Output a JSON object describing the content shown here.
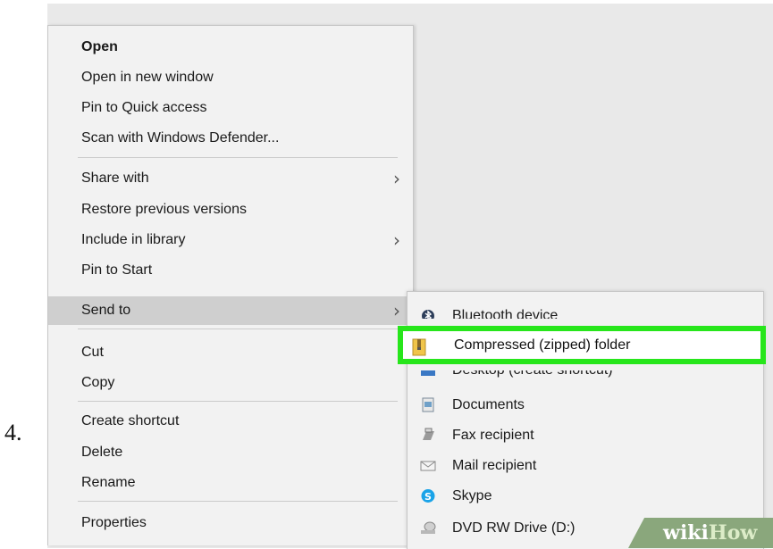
{
  "step_number": "4.",
  "context_menu": {
    "items": [
      {
        "label": "Open",
        "bold": true
      },
      {
        "label": "Open in new window"
      },
      {
        "label": "Pin to Quick access"
      },
      {
        "label": "Scan with Windows Defender..."
      },
      {
        "label": "Share with",
        "submenu": true
      },
      {
        "label": "Restore previous versions"
      },
      {
        "label": "Include in library",
        "submenu": true
      },
      {
        "label": "Pin to Start"
      },
      {
        "label": "Send to",
        "submenu": true,
        "highlighted": true
      },
      {
        "label": "Cut"
      },
      {
        "label": "Copy"
      },
      {
        "label": "Create shortcut"
      },
      {
        "label": "Delete"
      },
      {
        "label": "Rename"
      },
      {
        "label": "Properties"
      }
    ]
  },
  "send_to_submenu": {
    "items": [
      {
        "label": "Bluetooth device",
        "icon": "bluetooth-icon"
      },
      {
        "label": "Compressed (zipped) folder",
        "icon": "zip-folder-icon",
        "highlighted": true
      },
      {
        "label": "Desktop (create shortcut)",
        "icon": "desktop-icon"
      },
      {
        "label": "Documents",
        "icon": "documents-icon"
      },
      {
        "label": "Fax recipient",
        "icon": "fax-icon"
      },
      {
        "label": "Mail recipient",
        "icon": "mail-icon"
      },
      {
        "label": "Skype",
        "icon": "skype-icon"
      },
      {
        "label": "DVD RW Drive (D:)",
        "icon": "dvd-drive-icon"
      }
    ]
  },
  "watermark": {
    "part1": "wiki",
    "part2": "How"
  },
  "colors": {
    "highlight_box": "#27e61b",
    "menu_bg": "#f2f2f2",
    "hover_bg": "#cfcfcf"
  }
}
